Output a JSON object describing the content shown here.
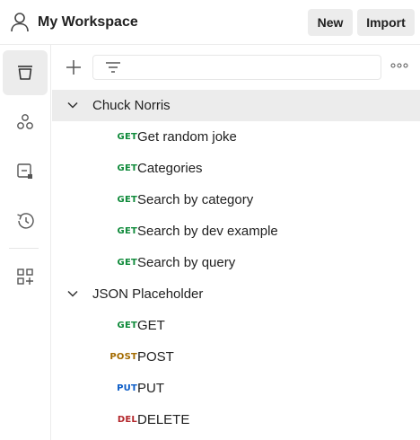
{
  "header": {
    "title": "My Workspace",
    "new_label": "New",
    "import_label": "Import"
  },
  "sidebar": {
    "items": [
      {
        "icon": "collections-icon",
        "active": true
      },
      {
        "icon": "apis-icon",
        "active": false
      },
      {
        "icon": "environments-icon",
        "active": false
      },
      {
        "icon": "history-icon",
        "active": false
      },
      {
        "icon": "configure-workbench-icon",
        "active": false
      }
    ]
  },
  "toolbar": {
    "search_placeholder": ""
  },
  "colors": {
    "GET": "#0f8a3a",
    "POST": "#a36b00",
    "PUT": "#0b5cc7",
    "DEL": "#b3262b"
  },
  "collections": [
    {
      "name": "Chuck Norris",
      "requests": [
        {
          "method": "GET",
          "name": "Get random joke"
        },
        {
          "method": "GET",
          "name": "Categories"
        },
        {
          "method": "GET",
          "name": "Search by category"
        },
        {
          "method": "GET",
          "name": "Search by dev example"
        },
        {
          "method": "GET",
          "name": "Search by query"
        }
      ]
    },
    {
      "name": "JSON Placeholder",
      "requests": [
        {
          "method": "GET",
          "name": "GET"
        },
        {
          "method": "POST",
          "name": "POST"
        },
        {
          "method": "PUT",
          "name": "PUT"
        },
        {
          "method": "DEL",
          "name": "DELETE"
        }
      ]
    }
  ]
}
